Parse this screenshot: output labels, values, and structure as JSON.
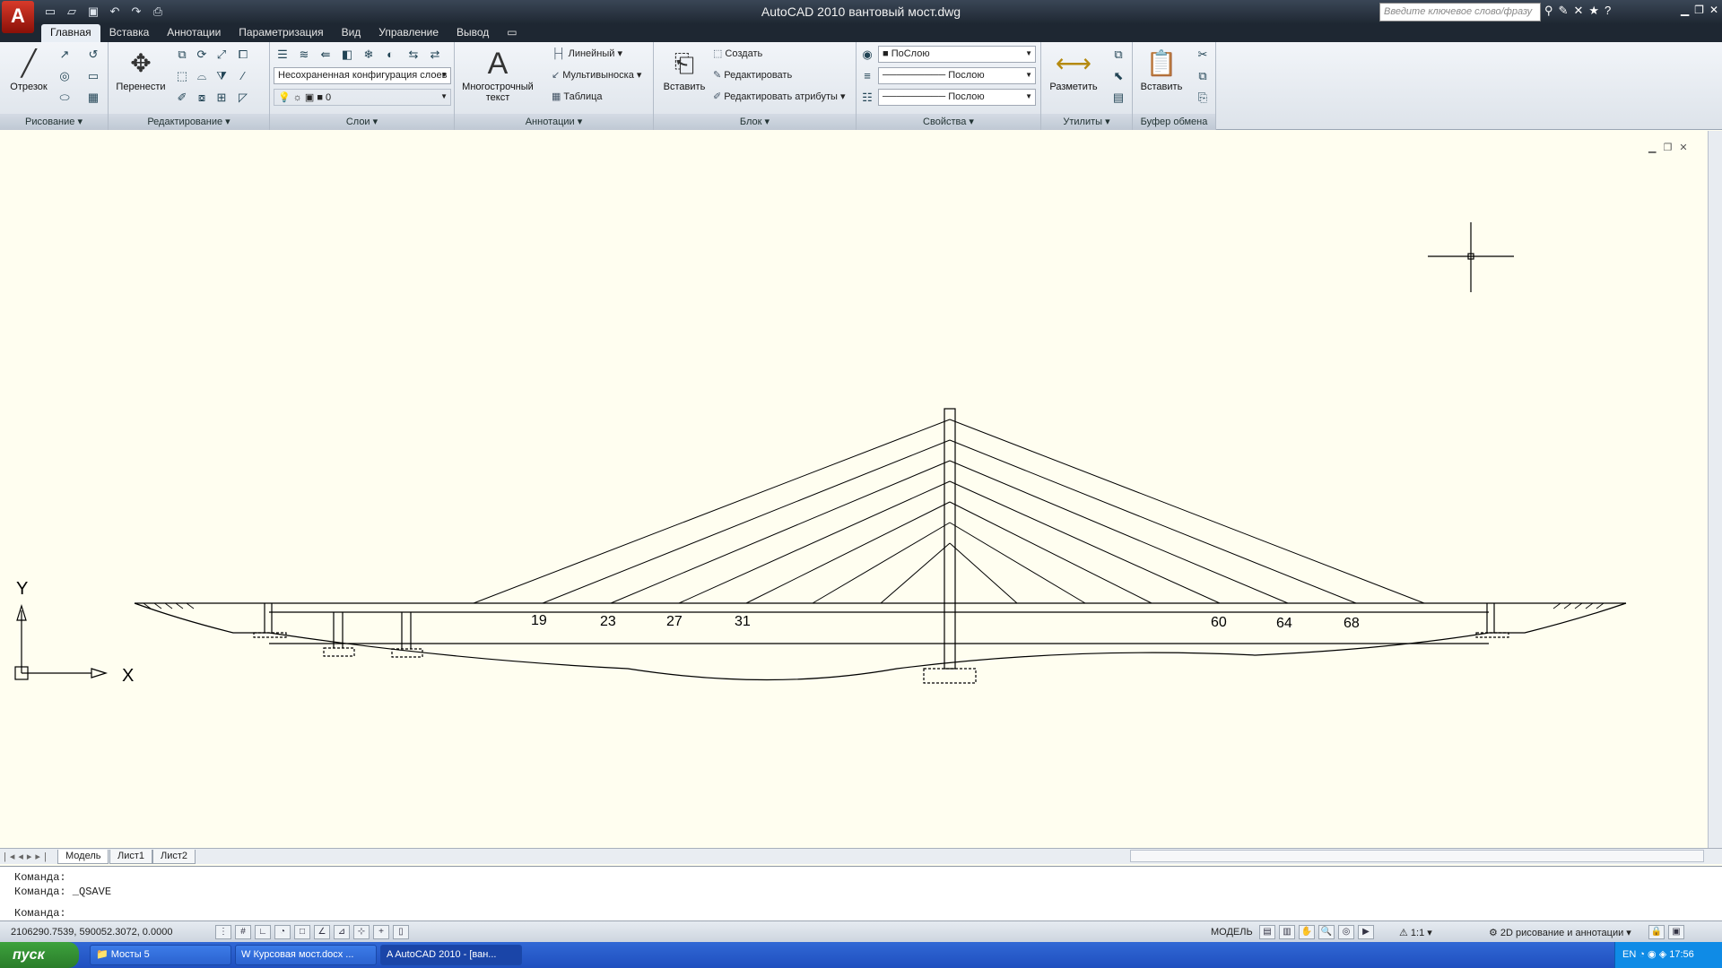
{
  "app": {
    "title": "AutoCAD 2010    вантовый мост.dwg",
    "logo_letter": "A",
    "search_placeholder": "Введите ключевое слово/фразу"
  },
  "quick_access": [
    "new-icon",
    "open-icon",
    "save-icon",
    "undo-icon",
    "redo-icon",
    "plot-icon"
  ],
  "tabs": [
    "Главная",
    "Вставка",
    "Аннотации",
    "Параметризация",
    "Вид",
    "Управление",
    "Вывод"
  ],
  "active_tab": "Главная",
  "ribbon": {
    "draw": {
      "label": "Рисование",
      "line": "Отрезок"
    },
    "modify": {
      "label": "Редактирование",
      "move": "Перенести"
    },
    "layers": {
      "label": "Слои",
      "layer_state": "Несохраненная конфигурация слоев",
      "current_layer": "0"
    },
    "annotation": {
      "label": "Аннотации",
      "mtext_1": "Многострочный",
      "mtext_2": "текст",
      "linear": "Линейный",
      "mleader": "Мультивыноска",
      "table": "Таблица"
    },
    "block": {
      "label": "Блок",
      "insert": "Вставить",
      "create": "Создать",
      "edit": "Редактировать",
      "edit_attr": "Редактировать атрибуты"
    },
    "properties": {
      "label": "Свойства",
      "color": "ПоСлою",
      "lineweight": "Послою",
      "linetype": "Послою"
    },
    "utilities": {
      "label": "Утилиты",
      "measure": "Разметить"
    },
    "clipboard": {
      "label": "Буфер обмена",
      "paste": "Вставить"
    }
  },
  "drawing": {
    "labels_left": [
      "19",
      "23",
      "27",
      "31"
    ],
    "labels_right": [
      "60",
      "64",
      "68"
    ],
    "ucs_x": "X",
    "ucs_y": "Y"
  },
  "layout_tabs": [
    "Модель",
    "Лист1",
    "Лист2"
  ],
  "command_lines": [
    "Команда:",
    "Команда: _QSAVE",
    "Команда:"
  ],
  "status": {
    "coords": "2106290.7539, 590052.3072, 0.0000",
    "model": "МОДЕЛЬ",
    "scale": "1:1",
    "workspace": "2D рисование и аннотации"
  },
  "taskbar": {
    "start": "пуск",
    "items": [
      "Мосты 5",
      "Курсовая мост.docx ...",
      "AutoCAD 2010 - [ван..."
    ],
    "lang": "EN",
    "time": "17:56"
  },
  "colors": {
    "canvas": "#fffef0",
    "title": "#1e2732",
    "taskbar": "#245edb"
  }
}
